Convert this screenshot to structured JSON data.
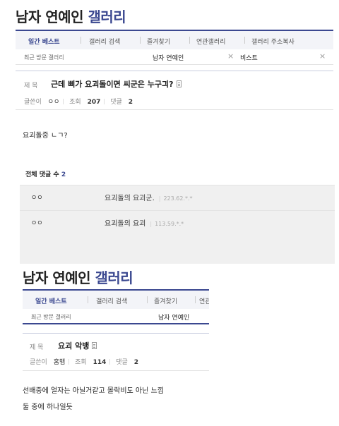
{
  "shot1": {
    "gallery_title_main": "남자 연예인",
    "gallery_title_accent": "갤러리",
    "nav_tabs": [
      "일간 베스트",
      "갤러리 검색",
      "즐겨찾기",
      "연관갤러리",
      "갤러리 주소복사"
    ],
    "recent_label": "최근 방문 갤러리",
    "recent_items": [
      "남자 연예인",
      "비스트"
    ],
    "close_glyph": "×",
    "subject_label": "제 목",
    "subject": "근데 삐가 요괴돌이면 씨군은 누구긔?",
    "author_label": "글쓴이",
    "author": "ㅇㅇ",
    "views_label": "조회",
    "views": "207",
    "comments_label": "댓글",
    "comments": "2",
    "body": "요괴돌중 ㄴㄱ?",
    "comment_total_label": "전체 댓글 수",
    "comment_total": "2",
    "comment_list": [
      {
        "author": "ㅇㅇ",
        "text": "요괴돌의 요괴군.",
        "ip": "223.62.*.*"
      },
      {
        "author": "ㅇㅇ",
        "text": "요괴돌의 요괴",
        "ip": "113.59.*.*"
      }
    ]
  },
  "shot2": {
    "gallery_title_main": "남자 연예인",
    "gallery_title_accent": "갤러리",
    "nav_tabs": [
      "일간 베스트",
      "갤러리 검색",
      "즐겨찾기",
      "연관"
    ],
    "recent_label": "최근 방문 갤러리",
    "recent_items": [
      "남자 연예인"
    ],
    "subject_label": "제 목",
    "subject": "요괴 악뱅",
    "author_label": "글쓴이",
    "author": "홈맴",
    "views_label": "조회",
    "views": "114",
    "comments_label": "댓글",
    "comments": "2",
    "body_lines": [
      "선배중에 얼자는 아닐거같고 몰락비도 아닌 느낌",
      "둘 중에 하나일듯"
    ]
  },
  "colors": {
    "accent": "#3b4890",
    "comment_bg": "#f0f0f0",
    "nav_bg": "#f3f4f8"
  }
}
